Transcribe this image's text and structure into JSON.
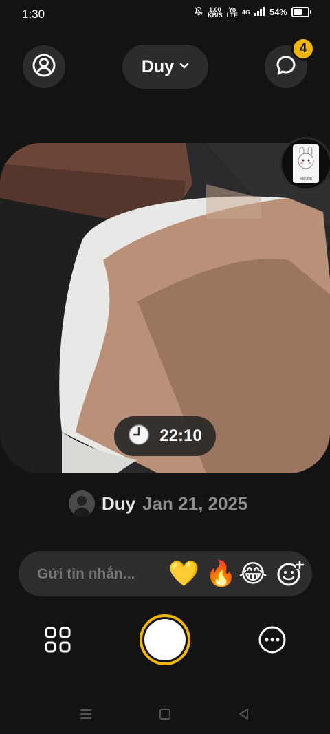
{
  "status": {
    "time": "1:30",
    "net_speed_top": "1.00",
    "net_speed_bottom": "KB/S",
    "volte_top": "Yo",
    "volte_bottom": "LTE",
    "network_label": "4G",
    "battery": "54%",
    "battery_level": 0.54
  },
  "header": {
    "friend_name": "Duy",
    "chat_badge_count": "4"
  },
  "photo": {
    "timestamp": "22:10",
    "thumb_caption": "sàm lồn"
  },
  "poster": {
    "name": "Duy",
    "date": "Jan 21, 2025"
  },
  "message": {
    "placeholder": "Gửi tin nhắn...",
    "reactions": [
      "💛",
      "🔥",
      "😂"
    ]
  },
  "colors": {
    "accent": "#f2b705",
    "background": "#131313",
    "surface": "#2c2c2c"
  }
}
